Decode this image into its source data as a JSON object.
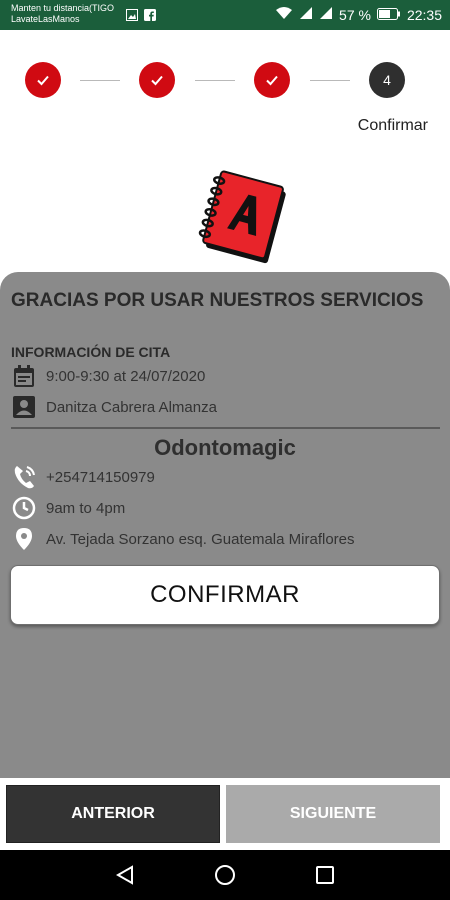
{
  "status_bar": {
    "notice_line1": "Manten tu distancia(TIGO",
    "notice_line2": "LavateLasManos",
    "battery": "57 %",
    "time": "22:35",
    "icons": [
      "image-icon",
      "facebook-icon",
      "wifi-icon",
      "signal-icon",
      "signal-icon",
      "battery-icon"
    ]
  },
  "stepper": {
    "current_step_number": "4",
    "caption": "Confirmar"
  },
  "card": {
    "thanks_title": "GRACIAS POR USAR NUESTROS SERVICIOS",
    "info_title": "INFORMACIÓN DE CITA",
    "appointment_time": "9:00-9:30 at 24/07/2020",
    "patient_name": "Danitza Cabrera Almanza",
    "clinic_name": "Odontomagic",
    "phone": "+254714150979",
    "hours": "9am to 4pm",
    "address": "Av. Tejada Sorzano esq. Guatemala Miraflores",
    "confirm_label": "CONFIRMAR"
  },
  "actions": {
    "prev_label": "ANTERIOR",
    "next_label": "SIGUIENTE"
  },
  "colors": {
    "status_bar": "#1b5e3b",
    "step_done": "#d00a12",
    "step_current": "#2f2f2f",
    "card_bg": "#8a8a8a",
    "prev_button": "#333333",
    "next_button": "#aaaaaa"
  }
}
